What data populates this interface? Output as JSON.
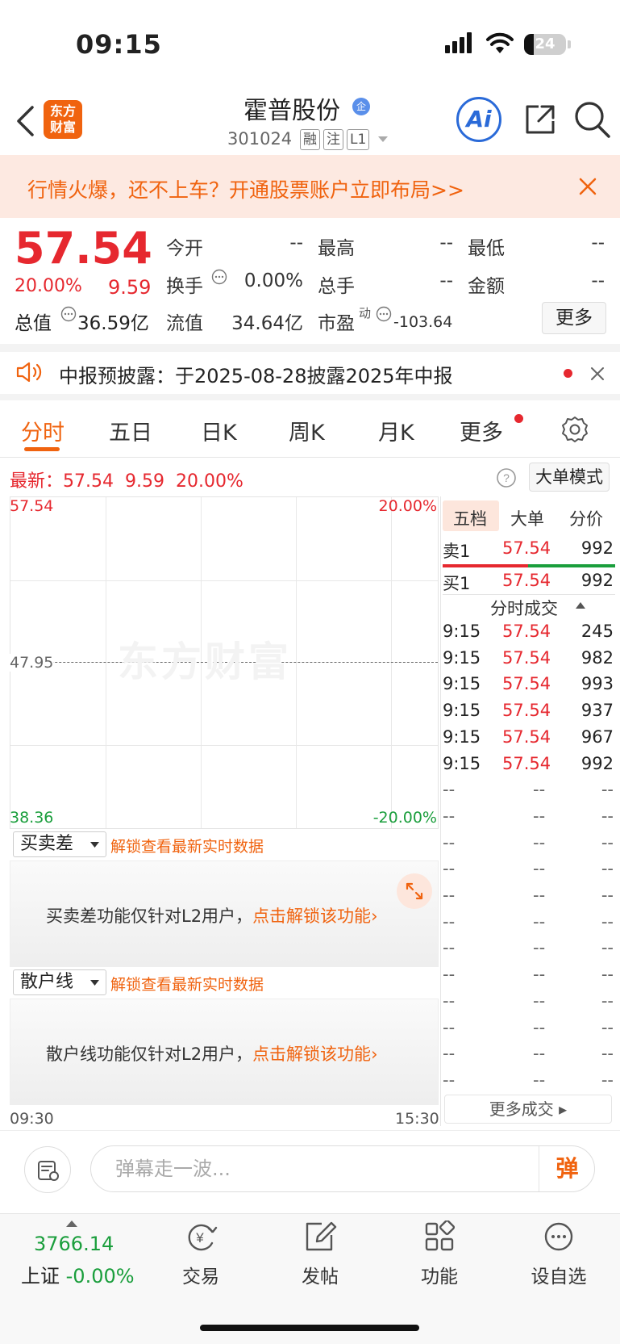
{
  "status_bar": {
    "time": "09:15",
    "battery": "24"
  },
  "header": {
    "logo_text": "东方\n财富",
    "stock_name": "霍普股份",
    "cert_badge": "企",
    "stock_code": "301024",
    "tags": [
      "融",
      "注",
      "L1"
    ]
  },
  "banner": {
    "text": "行情火爆，还不上车？开通股票账户立即布局>>"
  },
  "quote": {
    "price": "57.54",
    "change_pct": "20.00%",
    "change_amt": "9.59",
    "market_cap_label": "总值",
    "market_cap": "36.59亿",
    "open_label": "今开",
    "open": "--",
    "high_label": "最高",
    "high": "--",
    "low_label": "最低",
    "low": "--",
    "turnover_label": "换手",
    "turnover": "0.00%",
    "volume_label": "总手",
    "volume": "--",
    "amount_label": "金额",
    "amount": "--",
    "float_cap_label": "流值",
    "float_cap": "34.64亿",
    "pe_label": "市盈",
    "pe_sup": "动",
    "pe": "-103.64",
    "more_label": "更多"
  },
  "notice": {
    "text": "中报预披露：于2025-08-28披露2025年中报"
  },
  "tabs": [
    "分时",
    "五日",
    "日K",
    "周K",
    "月K",
    "更多"
  ],
  "chart_header": {
    "latest_label": "最新：",
    "latest_price": "57.54",
    "latest_change": "9.59",
    "latest_pct": "20.00%",
    "big_order_mode": "大单模式"
  },
  "chart_data": {
    "type": "line",
    "y_top": "57.54",
    "y_mid": "47.95",
    "y_bottom": "38.36",
    "pct_top": "20.00%",
    "pct_bottom": "-20.00%",
    "x_start": "09:30",
    "x_end": "15:30",
    "watermark": "东方财富",
    "series": []
  },
  "sub_panels": [
    {
      "select": "买卖差",
      "link": "解锁查看最新实时数据",
      "text": "买卖差功能仅针对L2用户，",
      "cta": "点击解锁该功能"
    },
    {
      "select": "散户线",
      "link": "解锁查看最新实时数据",
      "text": "散户线功能仅针对L2用户，",
      "cta": "点击解锁该功能"
    }
  ],
  "order_book": {
    "tabs": [
      "五档",
      "大单",
      "分价"
    ],
    "sell1": {
      "label": "卖1",
      "price": "57.54",
      "qty": "992"
    },
    "buy1": {
      "label": "买1",
      "price": "57.54",
      "qty": "992"
    },
    "trades_title": "分时成交",
    "trades": [
      {
        "time": "9:15",
        "price": "57.54",
        "qty": "245"
      },
      {
        "time": "9:15",
        "price": "57.54",
        "qty": "982"
      },
      {
        "time": "9:15",
        "price": "57.54",
        "qty": "993"
      },
      {
        "time": "9:15",
        "price": "57.54",
        "qty": "937"
      },
      {
        "time": "9:15",
        "price": "57.54",
        "qty": "967"
      },
      {
        "time": "9:15",
        "price": "57.54",
        "qty": "992"
      },
      {
        "time": "--",
        "price": "--",
        "qty": "--"
      },
      {
        "time": "--",
        "price": "--",
        "qty": "--"
      },
      {
        "time": "--",
        "price": "--",
        "qty": "--"
      },
      {
        "time": "--",
        "price": "--",
        "qty": "--"
      },
      {
        "time": "--",
        "price": "--",
        "qty": "--"
      },
      {
        "time": "--",
        "price": "--",
        "qty": "--"
      },
      {
        "time": "--",
        "price": "--",
        "qty": "--"
      },
      {
        "time": "--",
        "price": "--",
        "qty": "--"
      },
      {
        "time": "--",
        "price": "--",
        "qty": "--"
      },
      {
        "time": "--",
        "price": "--",
        "qty": "--"
      },
      {
        "time": "--",
        "price": "--",
        "qty": "--"
      },
      {
        "time": "--",
        "price": "--",
        "qty": "--"
      }
    ],
    "more_trades": "更多成交"
  },
  "danmaku": {
    "placeholder": "弹幕走一波...",
    "button": "弹"
  },
  "bottom_bar": {
    "index_value": "3766.14",
    "index_name": "上证",
    "index_pct": "-0.00%",
    "items": [
      "交易",
      "发帖",
      "功能",
      "设自选"
    ]
  }
}
